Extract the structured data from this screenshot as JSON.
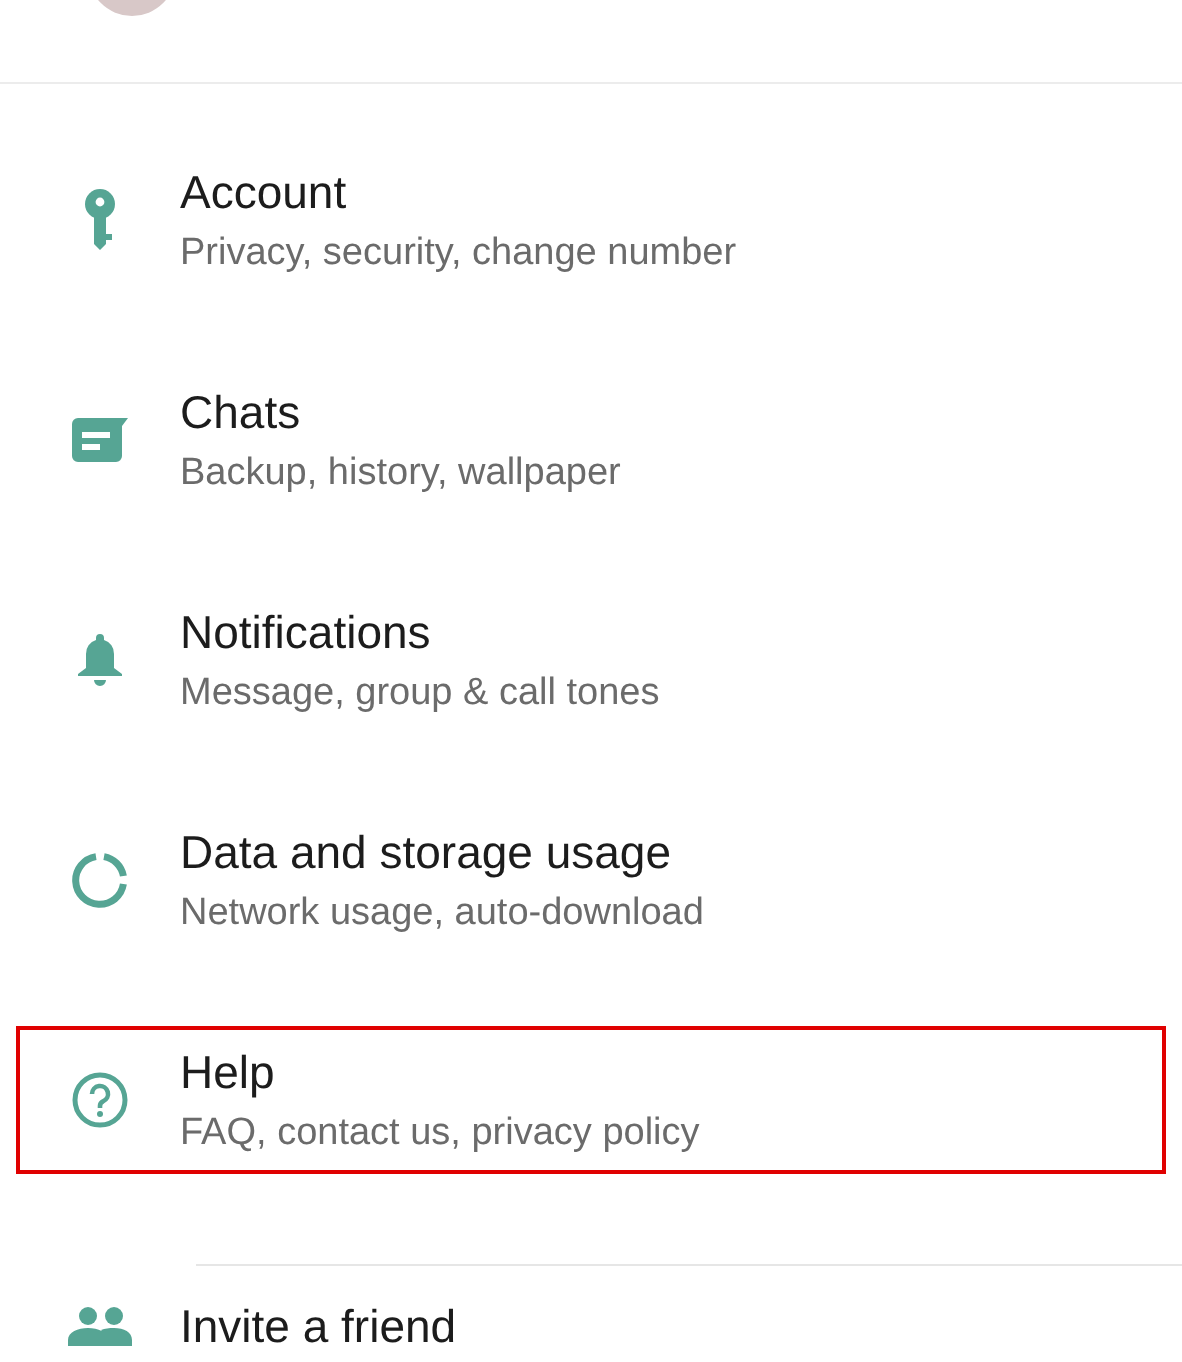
{
  "settings": [
    {
      "kind": "account",
      "title": "Account",
      "subtitle": "Privacy, security, change number",
      "highlighted": false
    },
    {
      "kind": "chats",
      "title": "Chats",
      "subtitle": "Backup, history, wallpaper",
      "highlighted": false
    },
    {
      "kind": "notifications",
      "title": "Notifications",
      "subtitle": "Message, group & call tones",
      "highlighted": false
    },
    {
      "kind": "data",
      "title": "Data and storage usage",
      "subtitle": "Network usage, auto-download",
      "highlighted": false
    },
    {
      "kind": "help",
      "title": "Help",
      "subtitle": "FAQ, contact us, privacy policy",
      "highlighted": true
    }
  ],
  "extra": [
    {
      "kind": "invite",
      "title": "Invite a friend"
    }
  ]
}
